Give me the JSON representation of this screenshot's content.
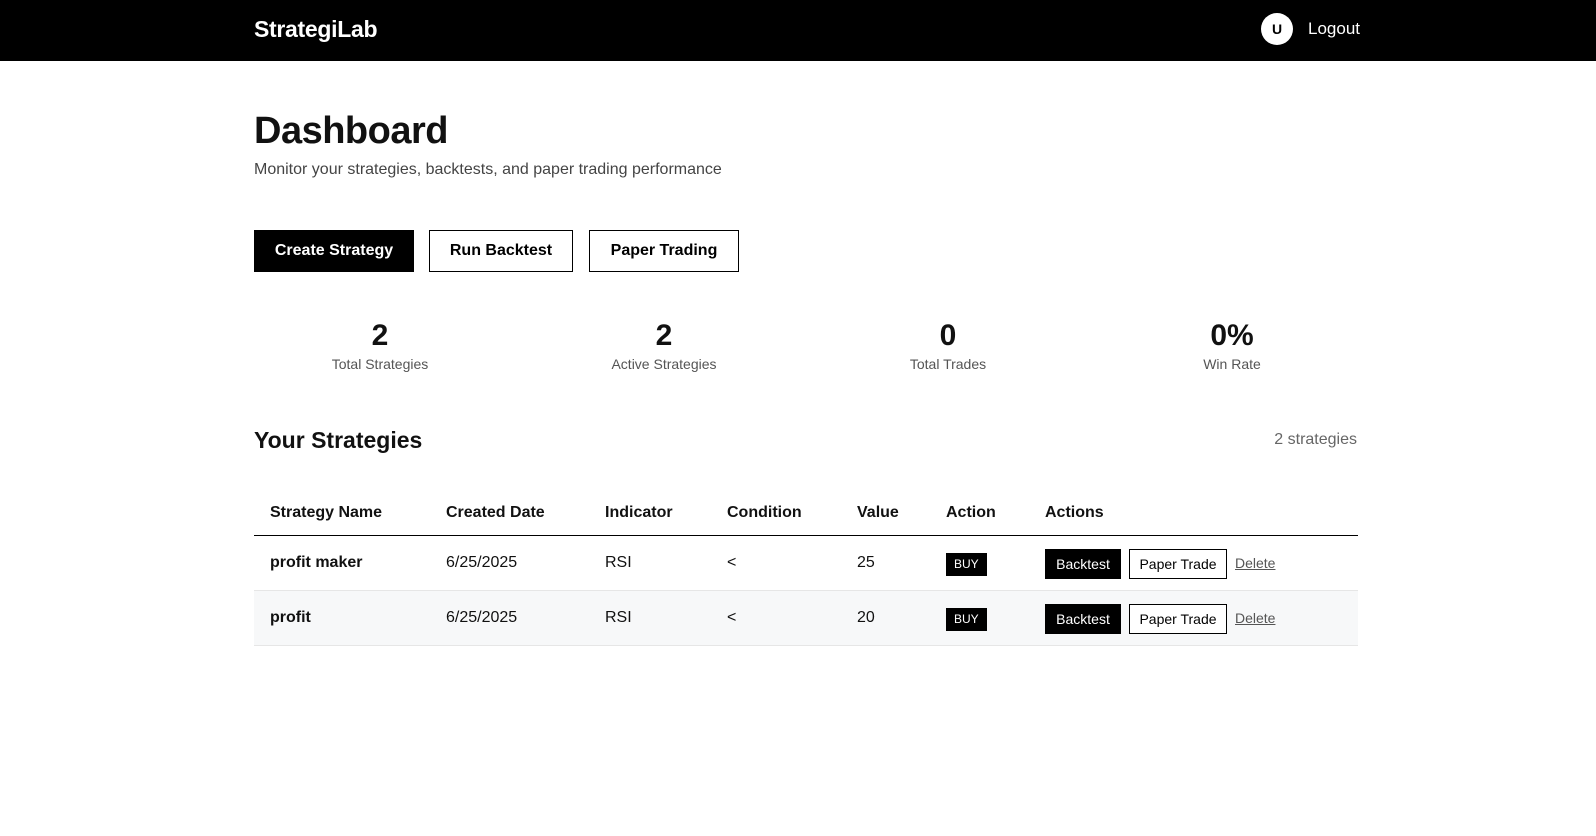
{
  "header": {
    "brand": "StrategiLab",
    "avatar_initial": "U",
    "logout_label": "Logout"
  },
  "page": {
    "title": "Dashboard",
    "subtitle": "Monitor your strategies, backtests, and paper trading performance"
  },
  "actions": {
    "create_label": "Create Strategy",
    "backtest_label": "Run Backtest",
    "paper_label": "Paper Trading"
  },
  "stats": [
    {
      "value": "2",
      "label": "Total Strategies"
    },
    {
      "value": "2",
      "label": "Active Strategies"
    },
    {
      "value": "0",
      "label": "Total Trades"
    },
    {
      "value": "0%",
      "label": "Win Rate"
    }
  ],
  "strategies": {
    "title": "Your Strategies",
    "count_text": "2 strategies",
    "columns": [
      "Strategy Name",
      "Created Date",
      "Indicator",
      "Condition",
      "Value",
      "Action",
      "Actions"
    ],
    "rows": [
      {
        "name": "profit maker",
        "created": "6/25/2025",
        "indicator": "RSI",
        "condition": "<",
        "value": "25",
        "action": "BUY",
        "backtest_label": "Backtest",
        "paper_label": "Paper Trade",
        "delete_label": "Delete"
      },
      {
        "name": "profit",
        "created": "6/25/2025",
        "indicator": "RSI",
        "condition": "<",
        "value": "20",
        "action": "BUY",
        "backtest_label": "Backtest",
        "paper_label": "Paper Trade",
        "delete_label": "Delete"
      }
    ]
  },
  "colors": {
    "header_bg": "#000000",
    "primary": "#000000",
    "row_alt_bg": "#f7f8f9"
  }
}
